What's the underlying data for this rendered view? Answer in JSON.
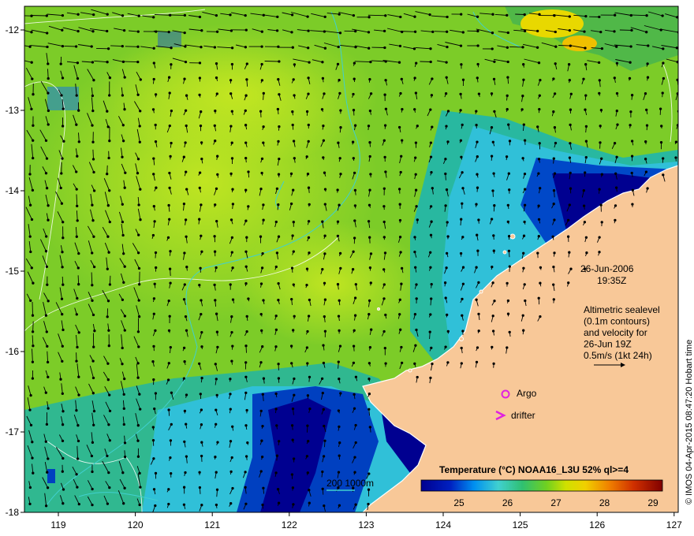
{
  "map": {
    "date_line": "26-Jun-2006",
    "time_line": "19:35Z",
    "description_lines": [
      "Altimetric sealevel",
      "(0.1m contours)",
      "and velocity for",
      "26-Jun 19Z",
      "0.5m/s (1kt 24h)"
    ],
    "legend_argo": "Argo",
    "legend_drifter": "drifter",
    "depth_label": "200  1000m",
    "credit": "© IMOS 04-Apr-2015 08:47:20 Hobart time",
    "lon_ticks": [
      "119",
      "120",
      "121",
      "122",
      "123",
      "124",
      "125",
      "126",
      "127"
    ],
    "lat_ticks": [
      "-12",
      "-13",
      "-14",
      "-15",
      "-16",
      "-17",
      "-18"
    ],
    "colorbar": {
      "title": "Temperature (°C) NOAA16_L3U 52% ql>=4",
      "ticks": [
        "25",
        "26",
        "27",
        "28",
        "29"
      ]
    },
    "colors": {
      "land": "#f8c898",
      "shelf_contour": "#40d0d0",
      "argo": "#e020e0",
      "drifter": "#e020e0"
    }
  }
}
